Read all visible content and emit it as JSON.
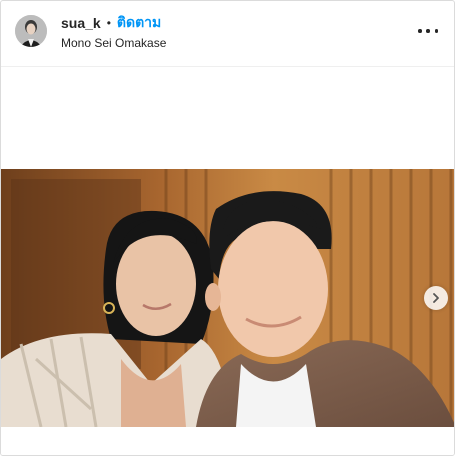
{
  "post": {
    "username": "sua_k",
    "separator": "•",
    "follow_label": "ติดตาม",
    "location": "Mono Sei Omakase",
    "more_icon": "more-horizontal-icon",
    "next_icon": "chevron-right-icon"
  },
  "colors": {
    "follow_blue": "#0095f6",
    "text": "#262626",
    "border": "#dbdbdb"
  }
}
